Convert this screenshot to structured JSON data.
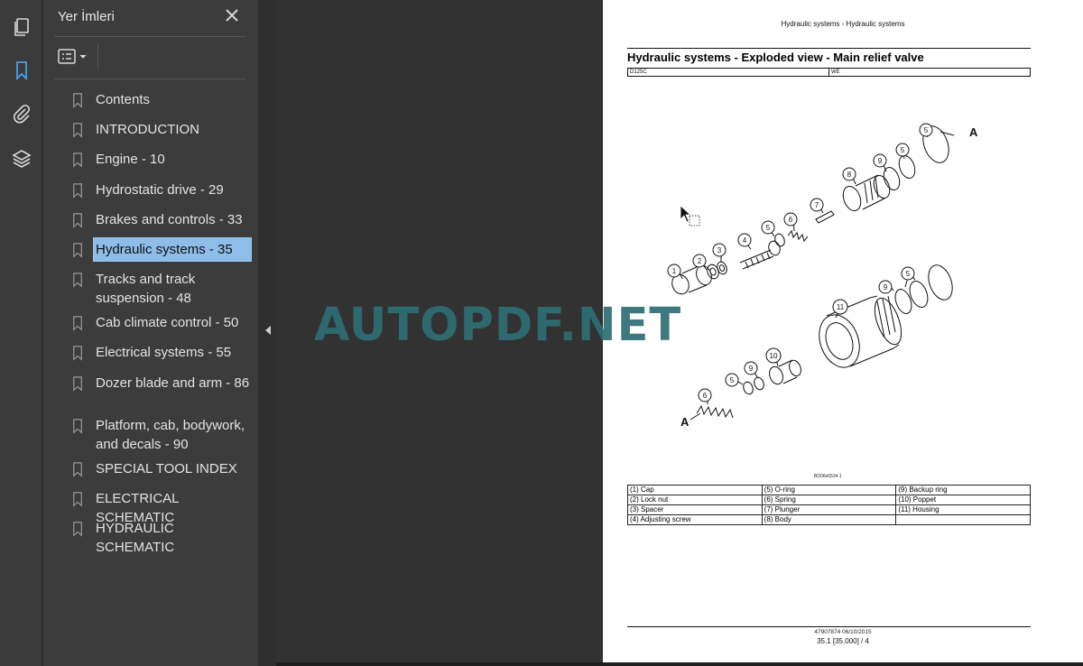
{
  "sidebar_panel": {
    "title": "Yer İmleri",
    "bookmarks": [
      {
        "label": "Contents"
      },
      {
        "label": "INTRODUCTION"
      },
      {
        "label": "Engine - 10"
      },
      {
        "label": "Hydrostatic drive - 29"
      },
      {
        "label": "Brakes and controls - 33"
      },
      {
        "label": "Hydraulic systems - 35",
        "selected": true
      },
      {
        "label": "Tracks and track suspension - 48"
      },
      {
        "label": "Cab climate control - 50"
      },
      {
        "label": "Electrical systems - 55"
      },
      {
        "label": "Dozer blade and arm - 86"
      },
      {
        "label": "Platform, cab, bodywork, and decals - 90"
      },
      {
        "label": "SPECIAL TOOL INDEX"
      },
      {
        "label": "ELECTRICAL SCHEMATIC"
      },
      {
        "label": "HYDRAULIC SCHEMATIC"
      }
    ]
  },
  "icons": {
    "rail": [
      "pages-icon",
      "bookmark-icon",
      "attachment-icon",
      "layers-icon"
    ],
    "active": "bookmark-icon",
    "accent": "#4a9ee8"
  },
  "watermark": "AUTOPDF.NET",
  "document": {
    "running_head": "Hydraulic systems - Hydraulic systems",
    "title": "Hydraulic systems - Exploded view - Main relief valve",
    "model": "D125C",
    "region": "WE",
    "figure_code": "BD06e6534    1",
    "callouts": {
      "a": "A",
      "n1": "1",
      "n2": "2",
      "n3": "3",
      "n4": "4",
      "n5": "5",
      "n6": "6",
      "n7": "7",
      "n8": "8",
      "n9": "9",
      "n10": "10",
      "n11": "11"
    },
    "legend": [
      [
        "(1) Cap",
        "(5) O-ring",
        "(9) Backup ring"
      ],
      [
        "(2) Lock nut",
        "(6) Spring",
        "(10) Poppet"
      ],
      [
        "(3) Spacer",
        "(7) Plunger",
        "(11) Housing"
      ],
      [
        "(4) Adjusting screw",
        "(8) Body",
        ""
      ]
    ],
    "footer_doc": "47907874 06/10/2015",
    "footer_page": "35.1 [35.000] / 4"
  }
}
